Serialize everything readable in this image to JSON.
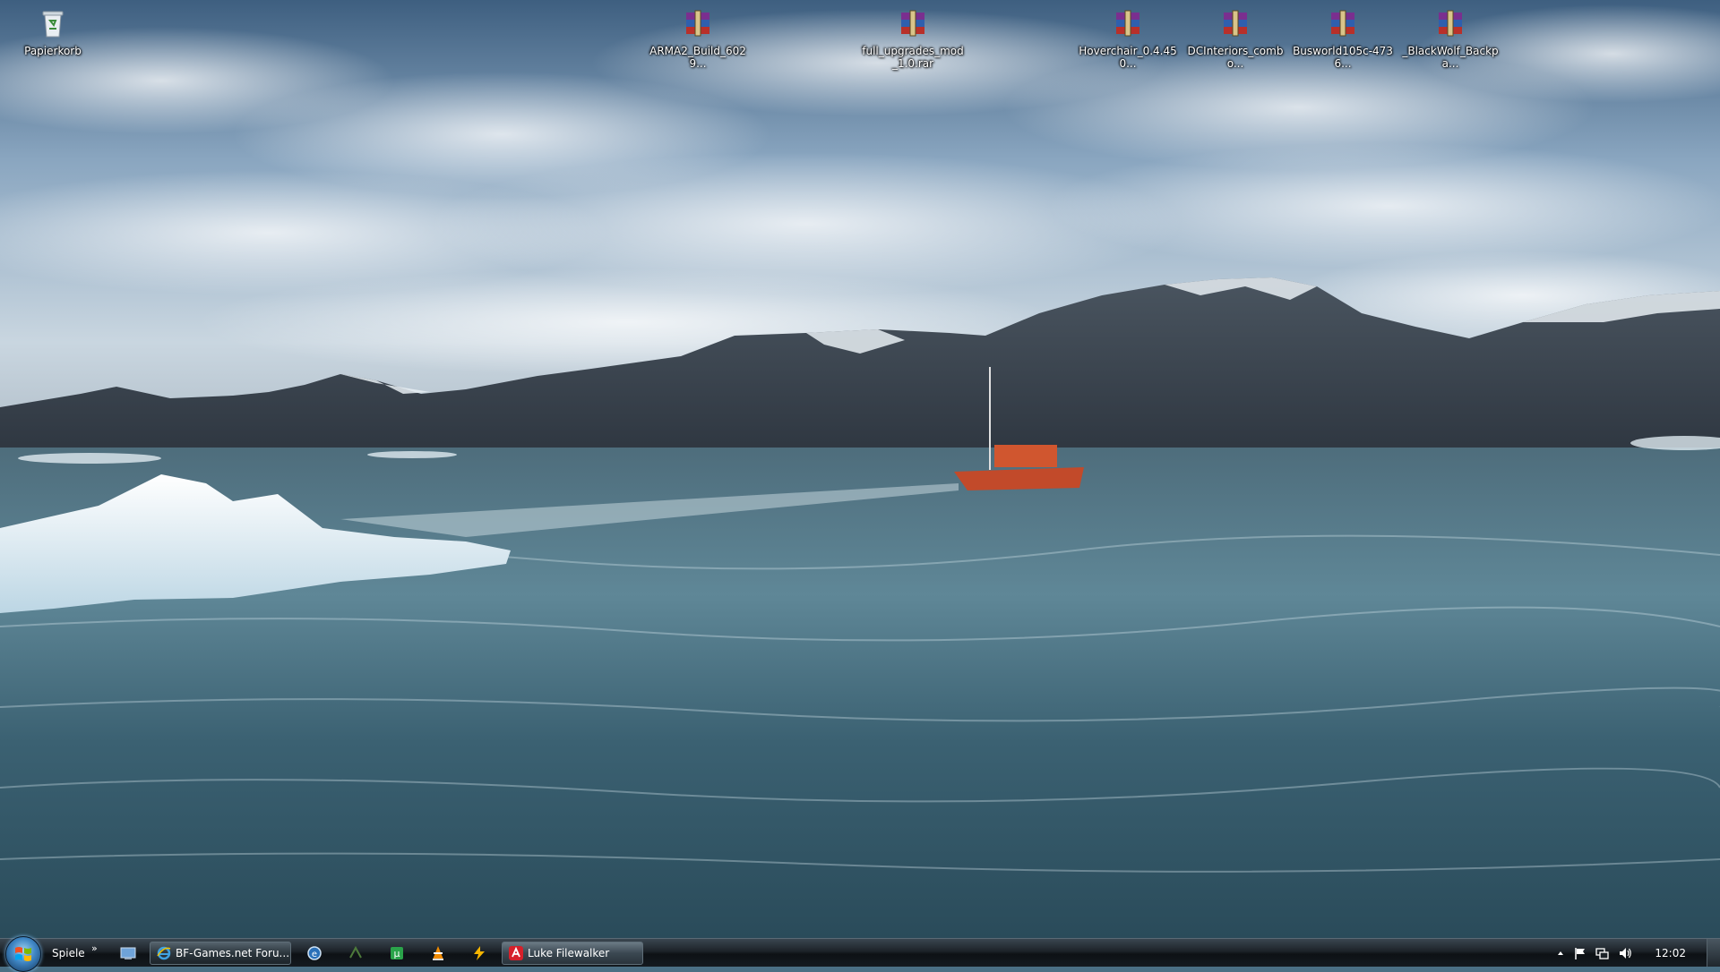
{
  "desktop": {
    "icons": [
      {
        "label": "Papierkorb",
        "icon": "recycle-bin-icon"
      },
      {
        "label": "ARMA2_Build_6029...",
        "icon": "winrar-archive-icon"
      },
      {
        "label": "full_upgrades_mod_1.0.rar",
        "icon": "winrar-archive-icon"
      },
      {
        "label": "Hoverchair_0.4.450...",
        "icon": "winrar-archive-icon"
      },
      {
        "label": "DCInteriors_combo...",
        "icon": "winrar-archive-icon"
      },
      {
        "label": "Busworld105c-4736...",
        "icon": "winrar-archive-icon"
      },
      {
        "label": "_BlackWolf_Backpa...",
        "icon": "winrar-archive-icon"
      }
    ]
  },
  "taskbar": {
    "start_icon": "windows-orb-icon",
    "toolbar_label": "Spiele",
    "toolbar_chevron": "»",
    "quick_launch": [
      "show-desktop-icon",
      "ie-icon",
      "app-icon",
      "utorrent-icon",
      "vlc-icon",
      "winamp-icon"
    ],
    "tasks": [
      {
        "label": "BF-Games.net Foru...",
        "icon": "internet-explorer-icon",
        "active": false
      },
      {
        "label": "Luke Filewalker",
        "icon": "antivir-icon",
        "active": true
      }
    ],
    "tray": {
      "icons": [
        "tray-expand-icon",
        "action-center-flag-icon",
        "network-icon",
        "volume-icon"
      ],
      "clock": "12:02"
    }
  },
  "colors": {
    "taskbar": "#161c21",
    "sky": "#7b9bb8",
    "water": "#3e6274",
    "archive_red": "#b8302a"
  }
}
